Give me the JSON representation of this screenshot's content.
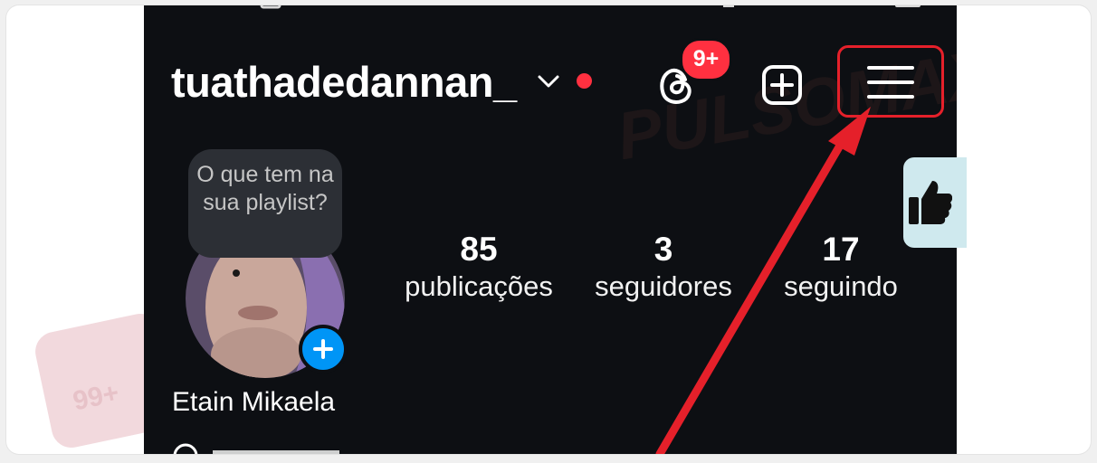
{
  "profile": {
    "username": "tuathadedannan_",
    "threads_badge": "9+",
    "note_text": "O que tem na sua playlist?",
    "display_name": "Etain Mikaela",
    "stats": [
      {
        "value": "85",
        "label": "publicações"
      },
      {
        "value": "3",
        "label": "seguidores"
      },
      {
        "value": "17",
        "label": "seguindo"
      }
    ]
  },
  "watermark": {
    "brand": "PULSOMAX",
    "badge": "99+"
  },
  "colors": {
    "background": "#0d0f13",
    "accent_red": "#ff3040",
    "highlight_red": "#e5202a",
    "story_blue": "#0095f6"
  },
  "icons": {
    "dropdown": "chevron-down-icon",
    "threads": "threads-icon",
    "create": "plus-square-icon",
    "menu": "hamburger-menu-icon",
    "add_story": "plus-icon"
  }
}
